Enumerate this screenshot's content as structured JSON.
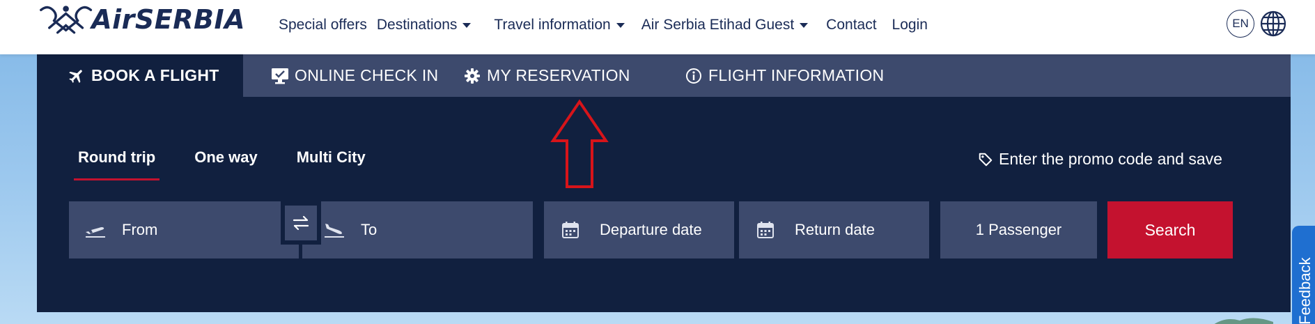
{
  "header": {
    "logo_text": "AirSERBIA",
    "nav": [
      {
        "label": "Special offers",
        "dropdown": false
      },
      {
        "label": "Destinations",
        "dropdown": true
      },
      {
        "label": "Travel information",
        "dropdown": true
      },
      {
        "label": "Air Serbia Etihad Guest",
        "dropdown": true
      },
      {
        "label": "Contact",
        "dropdown": false
      },
      {
        "label": "Login",
        "dropdown": false
      }
    ],
    "language": "EN",
    "globe_icon": "globe-icon"
  },
  "booking": {
    "tabs": [
      {
        "label": "BOOK A FLIGHT",
        "icon": "airplane-icon",
        "active": true
      },
      {
        "label": "ONLINE CHECK IN",
        "icon": "monitor-check-icon",
        "active": false
      },
      {
        "label": "MY RESERVATION",
        "icon": "gear-icon",
        "active": false
      },
      {
        "label": "FLIGHT INFORMATION",
        "icon": "info-icon",
        "active": false
      }
    ],
    "trip_types": [
      {
        "label": "Round trip",
        "active": true
      },
      {
        "label": "One way",
        "active": false
      },
      {
        "label": "Multi City",
        "active": false
      }
    ],
    "promo": "Enter the promo code and save",
    "from_placeholder": "From",
    "to_placeholder": "To",
    "departure_placeholder": "Departure date",
    "return_placeholder": "Return date",
    "passengers": "1 Passenger",
    "search_label": "Search"
  },
  "feedback_label": "Feedback",
  "colors": {
    "navy": "#11203f",
    "tab_bg": "#3d4a6d",
    "accent_red": "#c4122f",
    "brand_text": "#1a2b56"
  }
}
